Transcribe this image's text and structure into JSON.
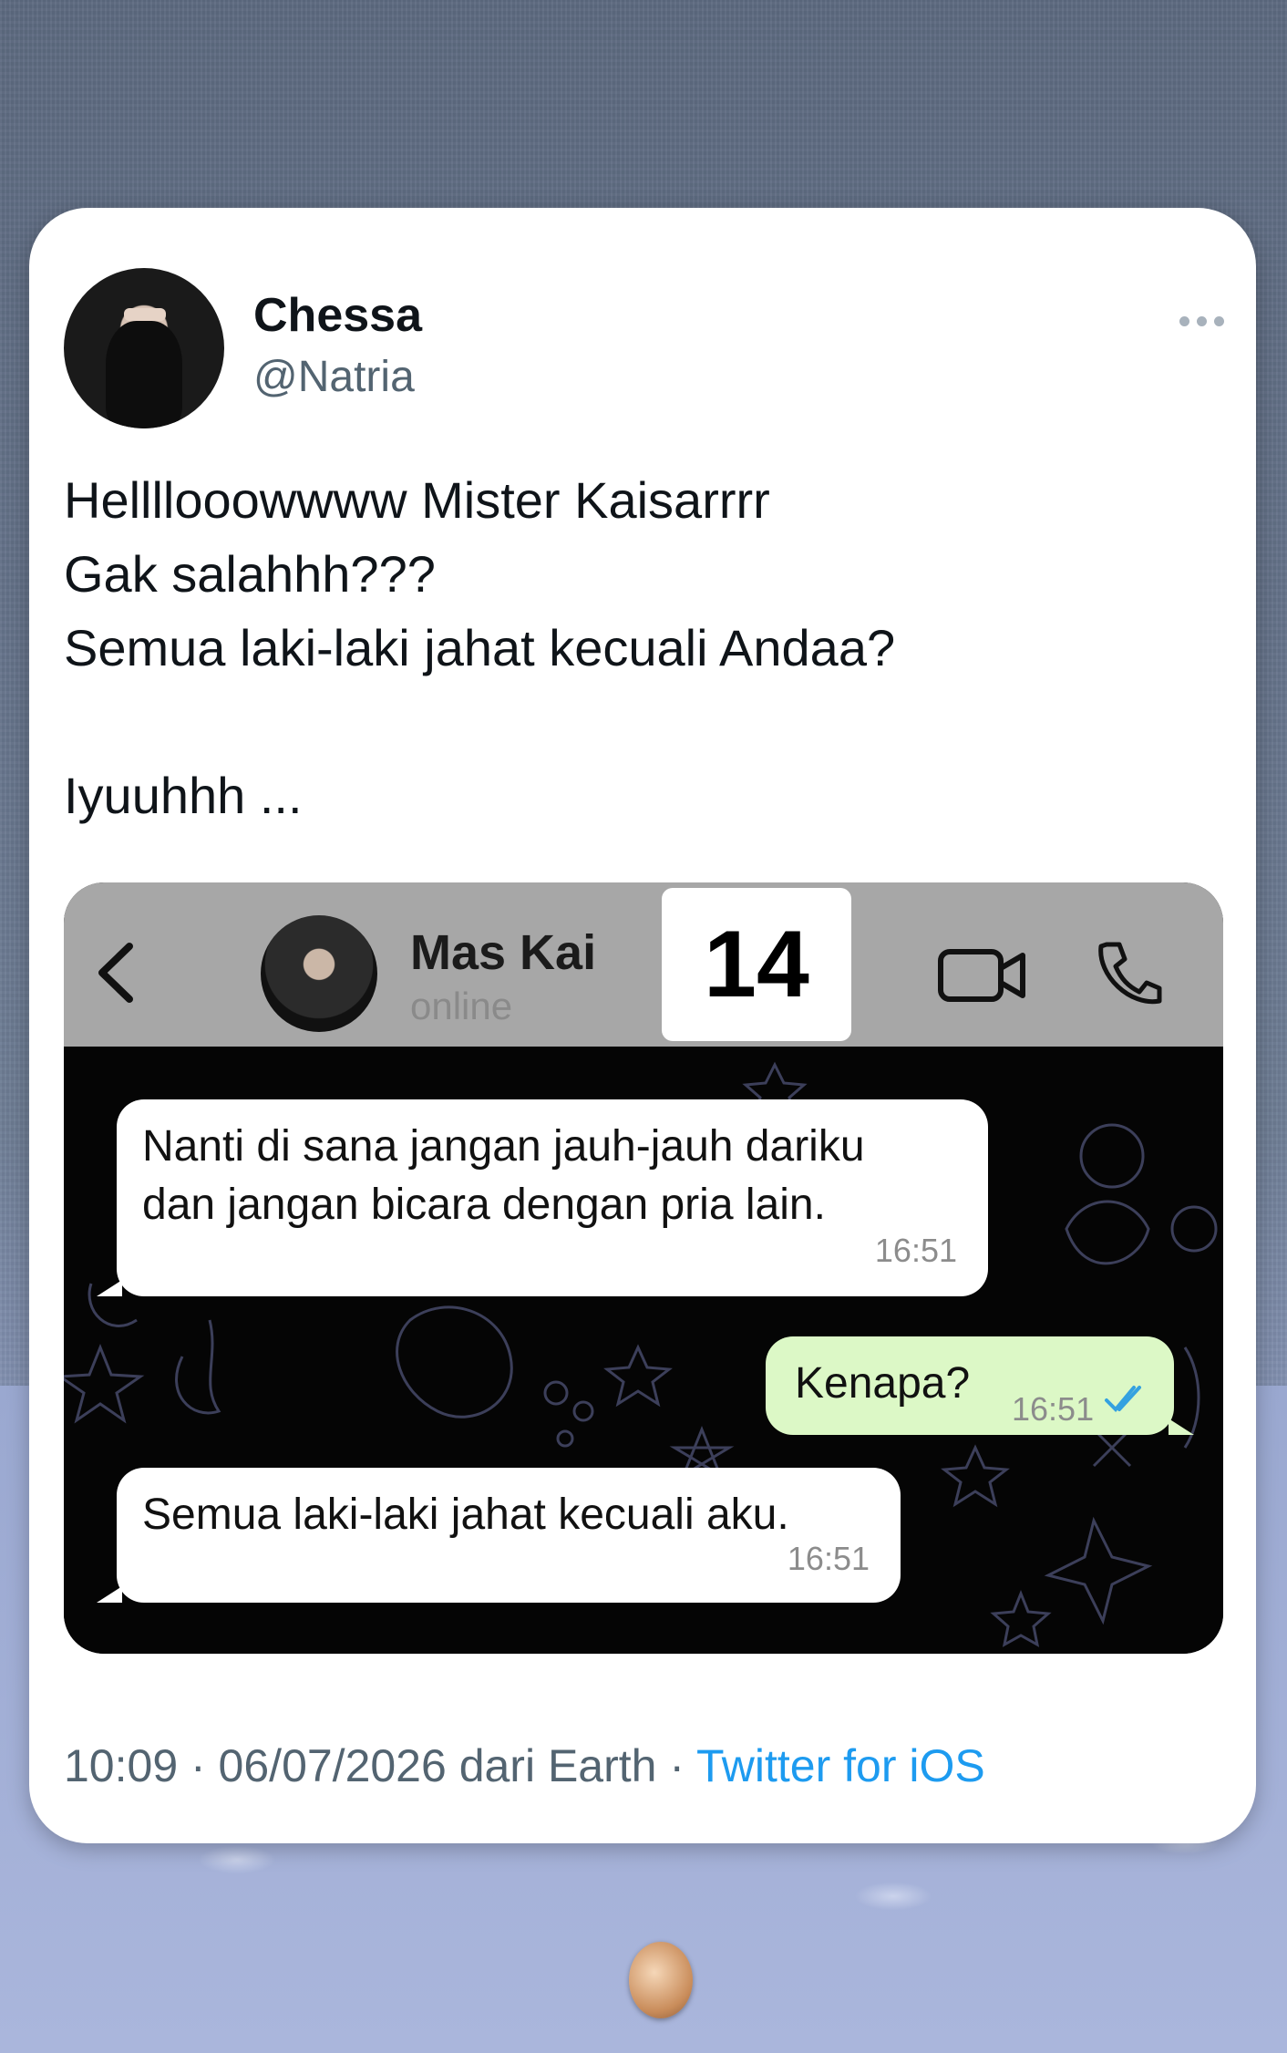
{
  "tweet": {
    "display_name": "Chessa",
    "handle": "@Natria",
    "text": "Hellllooowwww Mister Kaisarrrr\nGak salahhh???\nSemua laki-laki jahat kecuali Andaa?\n\nIyuuhhh ...",
    "timestamp": "10:09 · 06/07/2026 dari Earth · ",
    "source": "Twitter for iOS"
  },
  "chat": {
    "contact_name": "Mas Kai",
    "contact_status": "online",
    "badge": "14",
    "messages": [
      {
        "direction": "in",
        "text": "Nanti di sana jangan jauh-jauh dariku\ndan jangan bicara dengan pria lain.",
        "time": "16:51"
      },
      {
        "direction": "out",
        "text": "Kenapa?",
        "time": "16:51",
        "read": true
      },
      {
        "direction": "in",
        "text": "Semua laki-laki jahat kecuali aku.",
        "time": "16:51"
      }
    ]
  },
  "colors": {
    "link": "#1d9bf0",
    "outgoing_bubble": "#dcf8c6",
    "read_check": "#34a1e0"
  },
  "icons": [
    "more-icon",
    "back-icon",
    "video-call-icon",
    "phone-call-icon",
    "double-check-icon"
  ]
}
